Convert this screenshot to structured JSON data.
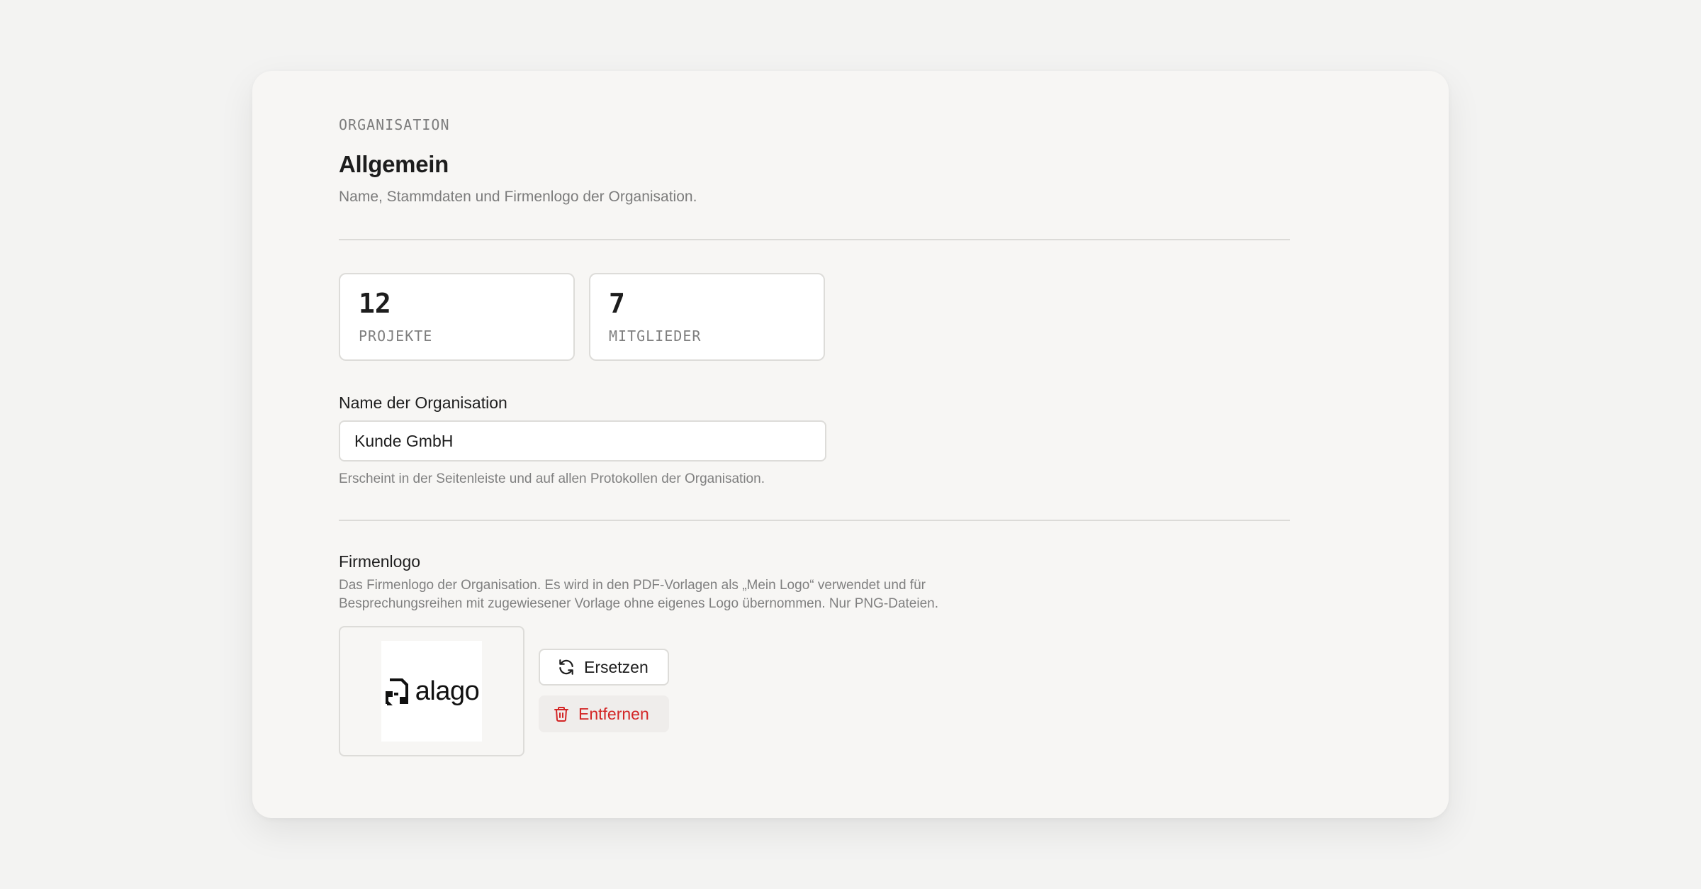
{
  "header": {
    "eyebrow": "ORGANISATION",
    "title": "Allgemein",
    "subtitle": "Name, Stammdaten und Firmenlogo der Organisation."
  },
  "stats": [
    {
      "value": "12",
      "label": "PROJEKTE"
    },
    {
      "value": "7",
      "label": "MITGLIEDER"
    }
  ],
  "org_name": {
    "label": "Name der Organisation",
    "value": "Kunde GmbH",
    "hint": "Erscheint in der Seitenleiste und auf allen Protokollen der Organisation."
  },
  "logo": {
    "title": "Firmenlogo",
    "description": "Das Firmenlogo der Organisation. Es wird in den PDF-Vorlagen als „Mein Logo“ verwendet und für Besprechungsreihen mit zugewiesener Vorlage ohne eigenes Logo übernommen. Nur PNG-Dateien.",
    "wordmark": "alago",
    "replace_label": "Ersetzen",
    "remove_label": "Entfernen",
    "replace_icon": "refresh-icon",
    "remove_icon": "trash-icon"
  },
  "colors": {
    "danger": "#d32626",
    "background": "#f3f3f2",
    "card": "#f7f6f4"
  }
}
